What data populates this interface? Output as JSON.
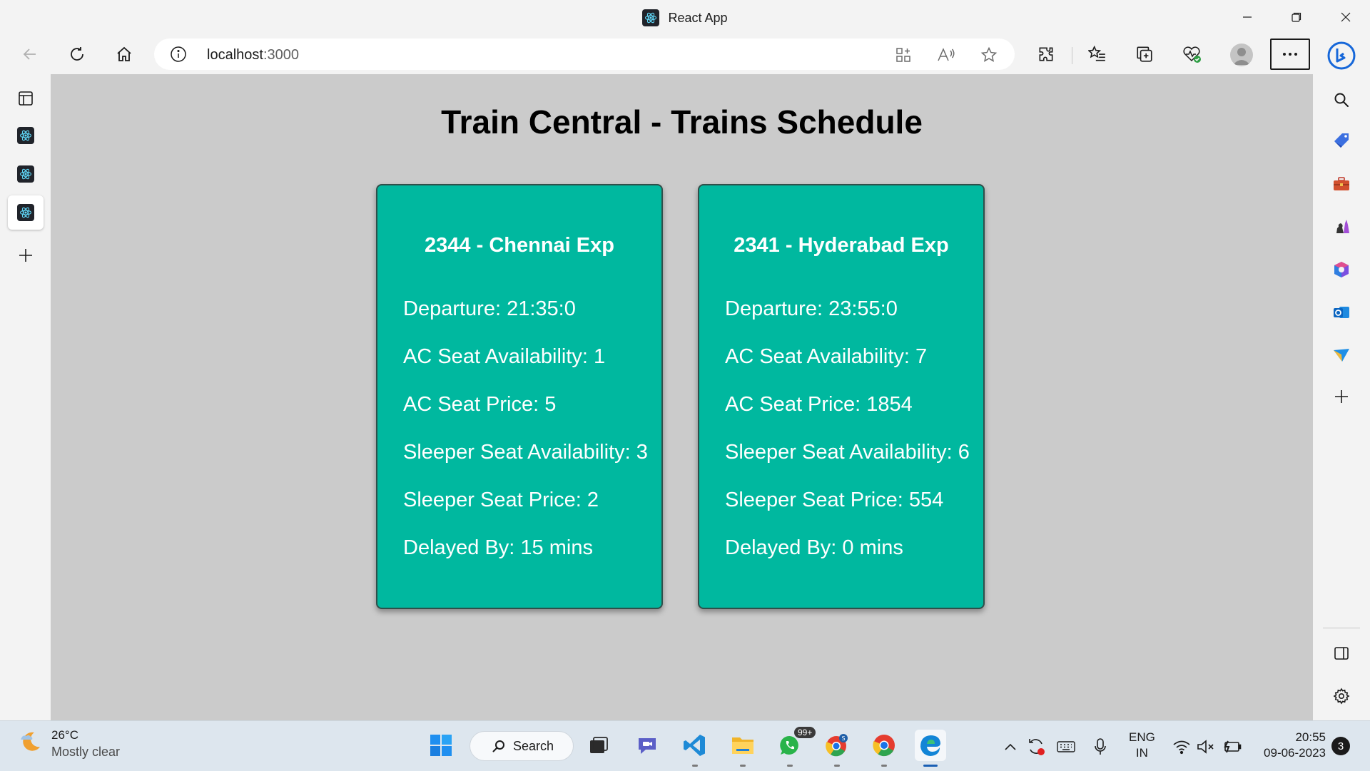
{
  "window": {
    "title": "React App"
  },
  "browser": {
    "url_host": "localhost",
    "url_port": ":3000"
  },
  "page": {
    "heading": "Train Central - Trains Schedule",
    "trains": [
      {
        "title": "2344 - Chennai Exp",
        "rows": [
          "Departure: 21:35:0",
          "AC Seat Availability: 1",
          "AC Seat Price: 5",
          "Sleeper Seat Availability: 3",
          "Sleeper Seat Price: 2",
          "Delayed By: 15 mins"
        ]
      },
      {
        "title": "2341 - Hyderabad Exp",
        "rows": [
          "Departure: 23:55:0",
          "AC Seat Availability: 7",
          "AC Seat Price: 1854",
          "Sleeper Seat Availability: 6",
          "Sleeper Seat Price: 554",
          "Delayed By: 0 mins"
        ]
      }
    ]
  },
  "taskbar": {
    "weather_temp": "26°C",
    "weather_condition": "Mostly clear",
    "search_label": "Search",
    "whatsapp_badge": "99+",
    "lang_primary": "ENG",
    "lang_region": "IN",
    "time": "20:55",
    "date": "09-06-2023",
    "notification_count": "3"
  },
  "colors": {
    "card_bg": "#00b89f",
    "page_bg": "#cbcbcb",
    "card_text": "#ffffff"
  }
}
